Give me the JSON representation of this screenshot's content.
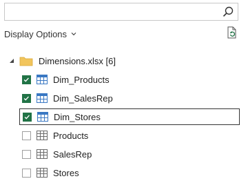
{
  "search": {
    "placeholder": ""
  },
  "toolbar": {
    "display_options": "Display Options"
  },
  "tree": {
    "root_label": "Dimensions.xlsx [6]",
    "items": [
      {
        "label": "Dim_Products",
        "checked": true
      },
      {
        "label": "Dim_SalesRep",
        "checked": true
      },
      {
        "label": "Dim_Stores",
        "checked": true,
        "selected": true
      },
      {
        "label": "Products",
        "checked": false
      },
      {
        "label": "SalesRep",
        "checked": false
      },
      {
        "label": "Stores",
        "checked": false
      }
    ]
  },
  "colors": {
    "accent": "#217346",
    "folder": "#f2c55c",
    "table_icon": "#3a78c3"
  },
  "icons": [
    "search-icon",
    "chevron-down-icon",
    "refresh-icon",
    "expander-icon",
    "folder-icon",
    "table-icon",
    "worksheet-icon",
    "checkbox-icon"
  ]
}
